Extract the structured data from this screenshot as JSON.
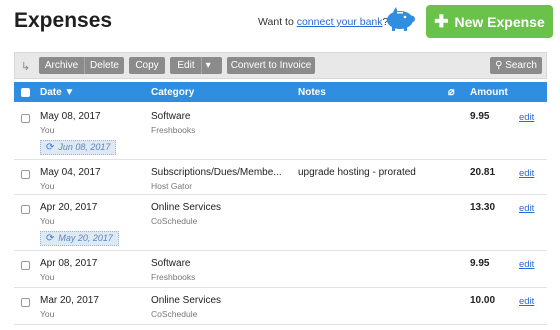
{
  "header": {
    "title": "Expenses",
    "bank_prefix": "Want to ",
    "bank_link": "connect your bank",
    "bank_suffix": "?",
    "new_button": "New Expense"
  },
  "toolbar": {
    "archive": "Archive",
    "delete": "Delete",
    "copy": "Copy",
    "edit": "Edit",
    "convert": "Convert to Invoice",
    "search": "Search"
  },
  "table": {
    "columns": {
      "date": "Date ▼",
      "category": "Category",
      "notes": "Notes",
      "amount": "Amount"
    },
    "rows": [
      {
        "date": "May 08, 2017",
        "who": "You",
        "category": "Software",
        "vendor": "Freshbooks",
        "notes": "",
        "amount": "9.95",
        "edit": "edit",
        "recurring": "Jun 08, 2017"
      },
      {
        "date": "May 04, 2017",
        "who": "You",
        "category": "Subscriptions/Dues/Membe...",
        "vendor": "Host Gator",
        "notes": "upgrade hosting - prorated",
        "amount": "20.81",
        "edit": "edit"
      },
      {
        "date": "Apr 20, 2017",
        "who": "You",
        "category": "Online Services",
        "vendor": "CoSchedule",
        "notes": "",
        "amount": "13.30",
        "edit": "edit",
        "recurring": "May 20, 2017"
      },
      {
        "date": "Apr 08, 2017",
        "who": "You",
        "category": "Software",
        "vendor": "Freshbooks",
        "notes": "",
        "amount": "9.95",
        "edit": "edit"
      },
      {
        "date": "Mar 20, 2017",
        "who": "You",
        "category": "Online Services",
        "vendor": "CoSchedule",
        "notes": "",
        "amount": "10.00",
        "edit": "edit"
      }
    ]
  },
  "icons": {
    "mascot": "pig-mascot-icon",
    "plus": "plus-icon",
    "sort": "sort-arrow-icon",
    "search": "search-icon",
    "attachment": "paperclip-icon",
    "recurring": "recurring-icon",
    "dropdown": "chevron-down-icon"
  },
  "colors": {
    "accent_green": "#6ac24b",
    "header_blue": "#2f8ee0",
    "link_blue": "#2a6ad6",
    "toolbar_button": "#8b8b8b"
  }
}
